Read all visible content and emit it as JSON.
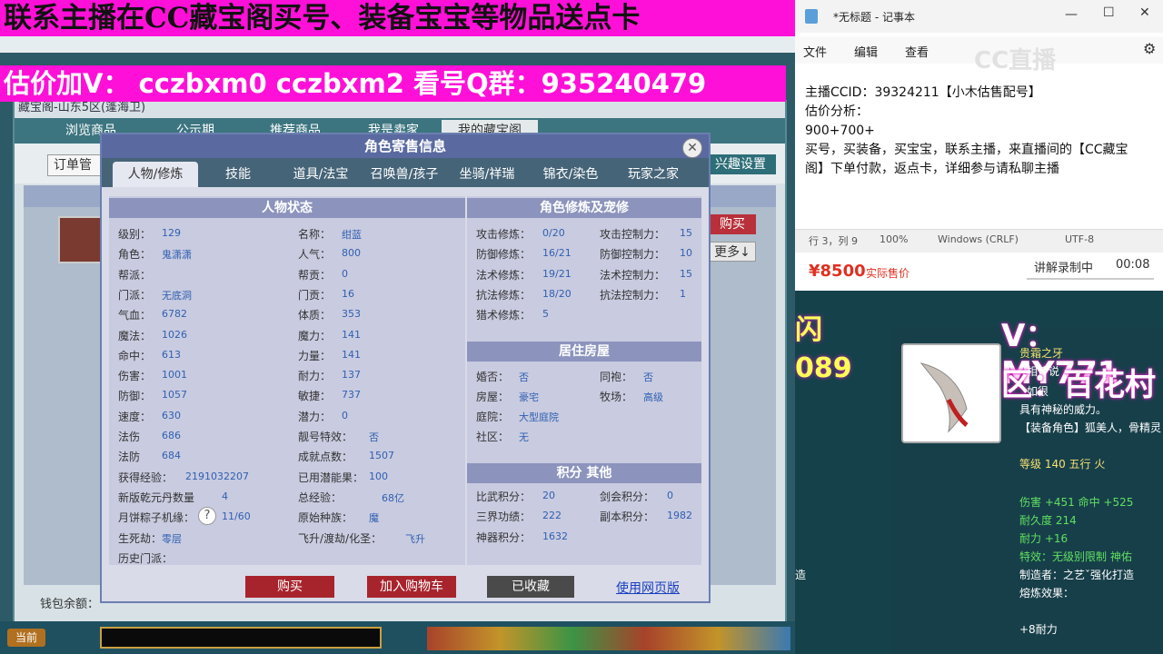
{
  "banner": {
    "line1": "联系主播在CC藏宝阁买号、装备宝宝等物品送点卡",
    "line2": "估价加V：  cczbxm0   cczbxm2   看号Q群：935240479"
  },
  "cbg": {
    "title": "藏宝阁-山东5区(蓬海卫)",
    "nav": [
      "浏览商品",
      "公示期",
      "推荐商品",
      "我是卖家",
      "我的藏宝阁"
    ],
    "order_btn": "订单管",
    "settings_btn": "兴趣设置",
    "side_buy": "购买",
    "side_more": "更多↓",
    "wallet": "钱包余额："
  },
  "dialog": {
    "title": "角色寄售信息",
    "tabs": [
      "人物/修炼",
      "技能",
      "道具/法宝",
      "召唤兽/孩子",
      "坐骑/祥瑞",
      "锦衣/染色",
      "玩家之家"
    ],
    "status_head": "人物状态",
    "status_left": [
      {
        "label": "级别：",
        "value": "129"
      },
      {
        "label": "角色：",
        "value": "鬼潇潇"
      },
      {
        "label": "帮派：",
        "value": ""
      },
      {
        "label": "门派：",
        "value": "无底洞"
      },
      {
        "label": "气血：",
        "value": "6782"
      },
      {
        "label": "魔法：",
        "value": "1026"
      },
      {
        "label": "命中：",
        "value": "613"
      },
      {
        "label": "伤害：",
        "value": "1001"
      },
      {
        "label": "防御：",
        "value": "1057"
      },
      {
        "label": "速度：",
        "value": "630"
      },
      {
        "label": "法伤",
        "value": "686"
      },
      {
        "label": "法防",
        "value": "684"
      },
      {
        "label": "获得经验：",
        "value": "2191032207"
      },
      {
        "label": "新版乾元丹数量",
        "value": "4"
      },
      {
        "label": "月饼粽子机缘：",
        "value": "11/60"
      },
      {
        "label": "生死劫：",
        "value": "零层"
      },
      {
        "label": "历史门派：",
        "value": ""
      }
    ],
    "status_right": [
      {
        "label": "名称：",
        "value": "绀蓝"
      },
      {
        "label": "人气：",
        "value": "800"
      },
      {
        "label": "帮贡：",
        "value": "0"
      },
      {
        "label": "门贡：",
        "value": "16"
      },
      {
        "label": "体质：",
        "value": "353"
      },
      {
        "label": "魔力：",
        "value": "141"
      },
      {
        "label": "力量：",
        "value": "141"
      },
      {
        "label": "耐力：",
        "value": "137"
      },
      {
        "label": "敏捷：",
        "value": "737"
      },
      {
        "label": "潜力：",
        "value": "0"
      },
      {
        "label": "靓号特效：",
        "value": "否"
      },
      {
        "label": "成就点数：",
        "value": "1507"
      },
      {
        "label": "已用潜能果：",
        "value": "100"
      },
      {
        "label": "总经验：",
        "value": "68亿"
      },
      {
        "label": "原始种族：",
        "value": "魔"
      },
      {
        "label": "飞升/渡劫/化圣：",
        "value": "飞升"
      }
    ],
    "cultivate_head": "角色修炼及宠修",
    "cultivate_left": [
      {
        "label": "攻击修炼：",
        "value": "0/20"
      },
      {
        "label": "防御修炼：",
        "value": "16/21"
      },
      {
        "label": "法术修炼：",
        "value": "19/21"
      },
      {
        "label": "抗法修炼：",
        "value": "18/20"
      },
      {
        "label": "猎术修炼：",
        "value": "5"
      }
    ],
    "cultivate_right": [
      {
        "label": "攻击控制力：",
        "value": "15"
      },
      {
        "label": "防御控制力：",
        "value": "10"
      },
      {
        "label": "法术控制力：",
        "value": "15"
      },
      {
        "label": "抗法控制力：",
        "value": "1"
      }
    ],
    "house_head": "居住房屋",
    "house_left": [
      {
        "label": "婚否：",
        "value": "否"
      },
      {
        "label": "房屋：",
        "value": "豪宅"
      },
      {
        "label": "庭院：",
        "value": "大型庭院"
      },
      {
        "label": "社区：",
        "value": "无"
      }
    ],
    "house_right": [
      {
        "label": "同袍：",
        "value": "否"
      },
      {
        "label": "牧场：",
        "value": "高级"
      }
    ],
    "score_head": "积分 其他",
    "score_left": [
      {
        "label": "比武积分：",
        "value": "20"
      },
      {
        "label": "三界功绩：",
        "value": "222"
      },
      {
        "label": "神器积分：",
        "value": "1632"
      }
    ],
    "score_right": [
      {
        "label": "剑会积分：",
        "value": "0"
      },
      {
        "label": "副本积分：",
        "value": "1982"
      }
    ],
    "btn_buy": "购买",
    "btn_cart": "加入购物车",
    "btn_fav": "已收藏",
    "link_web": "使用网页版"
  },
  "notepad": {
    "title": "*无标题 - 记事本",
    "menu": [
      "文件",
      "编辑",
      "查看"
    ],
    "lines": [
      "主播CCID：39324211【小木估售配号】",
      "估价分析：",
      "900+700+",
      "买号，买装备，买宝宝，联系主播，来直播间的【CC藏宝",
      "阁】下单付款，返点卡，详细参与请私聊主播"
    ],
    "status": {
      "pos": "行 3，列 9",
      "zoom": "100%",
      "eol": "Windows (CRLF)",
      "enc": "UTF-8"
    }
  },
  "stream": {
    "logo": "CC直播",
    "price": "¥8500",
    "price_label": "实际售价",
    "record_label": "讲解录制中",
    "record_time": "00:08",
    "overlay_v": "V：MY771",
    "overlay_qu": "区：百花村",
    "overlay_left_top": "闪",
    "overlay_left": "089"
  },
  "item": {
    "name": "贵霜之牙",
    "lines": [
      "相传说",
      "如很",
      "具有神秘的威力。",
      "【装备角色】狐美人，骨精灵",
      "等级 140 五行 火",
      "伤害 +451 命中 +525",
      "耐久度 214",
      "耐力 +16",
      "特效：无级别限制 神佑",
      "制造者：之艺ˇ强化打造",
      "熔炼效果：",
      "+8耐力"
    ],
    "side_text": "造"
  },
  "taskbar": {
    "label": "当前"
  }
}
